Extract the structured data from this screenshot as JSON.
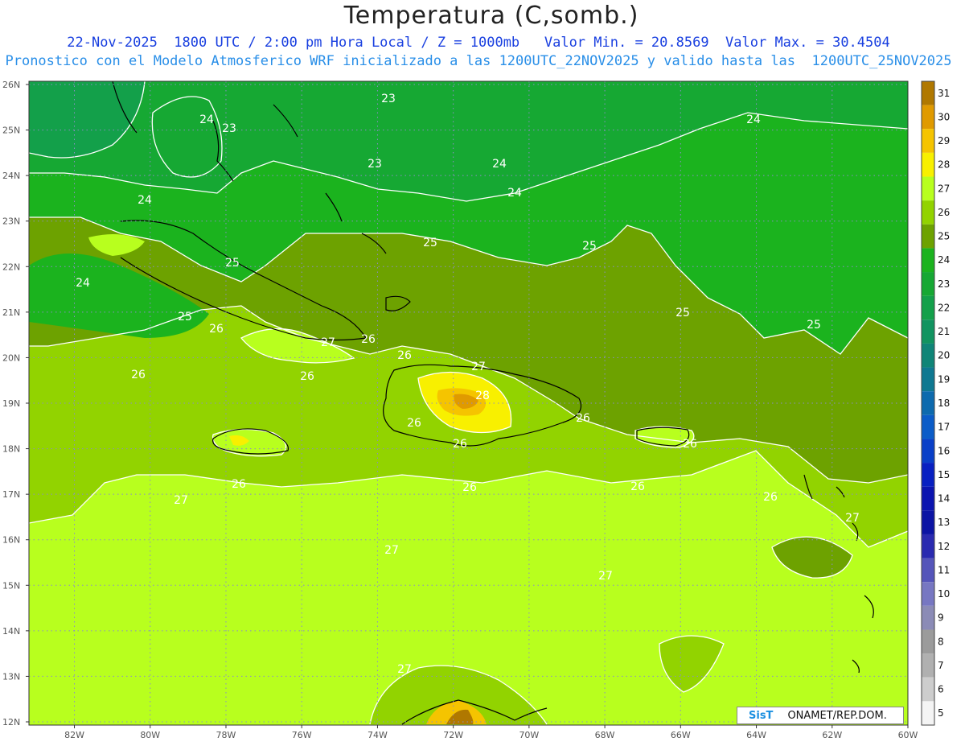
{
  "title": "Temperatura (C,somb.)",
  "subtitle_line1": "22-Nov-2025  1800 UTC / 2:00 pm Hora Local / Z = 1000mb   Valor Min. = 20.8569  Valor Max. = 30.4504",
  "subtitle_line2": "Pronostico con el Modelo Atmosferico WRF inicializado a las 1200UTC_22NOV2025 y valido hasta las  1200UTC_25NOV2025",
  "lat_labels": [
    "26N",
    "25N",
    "24N",
    "23N",
    "22N",
    "21N",
    "20N",
    "19N",
    "18N",
    "17N",
    "16N",
    "15N",
    "14N",
    "13N",
    "12N"
  ],
  "lon_labels": [
    "82W",
    "80W",
    "78W",
    "76W",
    "74W",
    "72W",
    "70W",
    "68W",
    "66W",
    "64W",
    "62W",
    "60W"
  ],
  "colorbar": {
    "levels": [
      "31",
      "30",
      "29",
      "28",
      "27",
      "26",
      "25",
      "24",
      "23",
      "22",
      "21",
      "20",
      "19",
      "18",
      "17",
      "16",
      "15",
      "14",
      "13",
      "12",
      "11",
      "10",
      "9",
      "8",
      "7",
      "6",
      "5"
    ],
    "colors": [
      "#b07800",
      "#e09a00",
      "#f5c400",
      "#f8f000",
      "#b8ff1e",
      "#92d300",
      "#6da200",
      "#1bb31e",
      "#16a833",
      "#13a04a",
      "#119460",
      "#0f8577",
      "#0e7891",
      "#0d6aae",
      "#0b5cc8",
      "#093fc8",
      "#0820c2",
      "#0b14b0",
      "#0c14a4",
      "#2a2ab0",
      "#5555ba",
      "#7777c2",
      "#8b8bb6",
      "#9b9b9b",
      "#b0b0b0",
      "#cdcdcd",
      "#f4f4f4"
    ]
  },
  "contour_labels": [
    "23",
    "24",
    "23",
    "24",
    "23",
    "24",
    "24",
    "24",
    "24",
    "25",
    "25",
    "25",
    "25",
    "25",
    "25",
    "26",
    "27",
    "26",
    "26",
    "26",
    "27",
    "26",
    "28",
    "26",
    "26",
    "26",
    "26",
    "26",
    "26",
    "26",
    "26",
    "27",
    "27",
    "27",
    "27",
    "27"
  ],
  "credit": {
    "logo": "SisT",
    "org": "ONAMET/REP.DOM."
  }
}
